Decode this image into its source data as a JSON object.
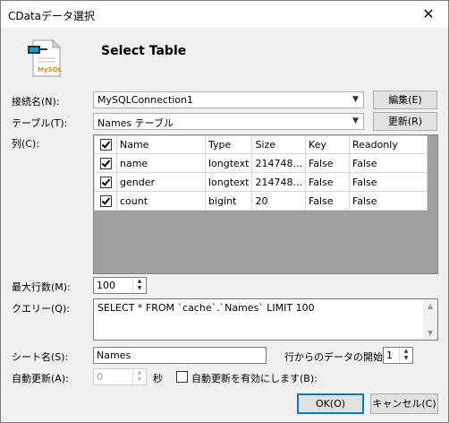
{
  "window": {
    "title": "CDataデータ選択",
    "close": "✕"
  },
  "header": {
    "title": "Select Table",
    "logo_text": "MySQL"
  },
  "connection": {
    "label": "接続名(N):",
    "value": "MySQLConnection1",
    "edit_button": "編集(E)"
  },
  "table": {
    "label": "テーブル(T):",
    "value": "Names テーブル",
    "refresh_button": "更新(R)"
  },
  "columns": {
    "label": "列(C):",
    "headers": [
      "Name",
      "Type",
      "Size",
      "Key",
      "Readonly"
    ],
    "rows": [
      {
        "checked": true,
        "name": "name",
        "type": "longtext",
        "size": "214748...",
        "key": "False",
        "readonly": "False"
      },
      {
        "checked": true,
        "name": "gender",
        "type": "longtext",
        "size": "214748...",
        "key": "False",
        "readonly": "False"
      },
      {
        "checked": true,
        "name": "count",
        "type": "bigint",
        "size": "20",
        "key": "False",
        "readonly": "False"
      }
    ]
  },
  "max_rows": {
    "label": "最大行数(M):",
    "value": "100"
  },
  "query": {
    "label": "クエリー(Q):",
    "value": "SELECT * FROM `cache`.`Names` LIMIT 100"
  },
  "sheet": {
    "label": "シート名(S):",
    "value": "Names",
    "start_label": "行からのデータの開始",
    "start_value": "1"
  },
  "auto_refresh": {
    "label": "自動更新(A):",
    "value": "0",
    "unit": "秒",
    "enable_label": "自動更新を有効にします(B):"
  },
  "buttons": {
    "ok": "OK(O)",
    "cancel": "キャンセル(C)"
  }
}
